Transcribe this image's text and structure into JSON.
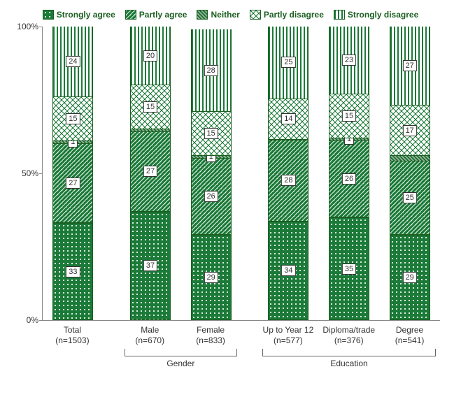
{
  "chart_data": {
    "type": "bar",
    "stacked": true,
    "ylim": [
      0,
      100
    ],
    "yticks": [
      "0%",
      "50%",
      "100%"
    ],
    "legend": [
      "Strongly agree",
      "Partly agree",
      "Neither",
      "Partly disagree",
      "Strongly disagree"
    ],
    "categories": [
      {
        "label_line1": "Total",
        "label_line2": "(n=1503)"
      },
      {
        "label_line1": "Male",
        "label_line2": "(n=670)"
      },
      {
        "label_line1": "Female",
        "label_line2": "(n=833)"
      },
      {
        "label_line1": "Up to Year 12",
        "label_line2": "(n=577)"
      },
      {
        "label_line1": "Diploma/trade",
        "label_line2": "(n=376)"
      },
      {
        "label_line1": "Degree",
        "label_line2": "(n=541)"
      }
    ],
    "series": [
      {
        "name": "Strongly agree",
        "values": [
          33,
          37,
          29,
          34,
          35,
          29
        ]
      },
      {
        "name": "Partly agree",
        "values": [
          27,
          27,
          26,
          28,
          26,
          25
        ]
      },
      {
        "name": "Neither",
        "values": [
          1,
          1,
          1,
          0,
          1,
          2
        ]
      },
      {
        "name": "Partly disagree",
        "values": [
          15,
          15,
          15,
          14,
          15,
          17
        ]
      },
      {
        "name": "Strongly disagree",
        "values": [
          24,
          20,
          28,
          25,
          23,
          27
        ]
      }
    ],
    "value_labels": [
      [
        "33",
        "27",
        "1",
        "15",
        "24"
      ],
      [
        "37",
        "27",
        "",
        "15",
        "20"
      ],
      [
        "29",
        "26",
        "1",
        "15",
        "28"
      ],
      [
        "34",
        "28",
        "",
        "14",
        "25"
      ],
      [
        "35",
        "26",
        "1",
        "15",
        "23"
      ],
      [
        "29",
        "25",
        "",
        "17",
        "27"
      ]
    ],
    "groups": [
      {
        "name": "Gender",
        "cols": [
          1,
          2
        ]
      },
      {
        "name": "Education",
        "cols": [
          3,
          4,
          5
        ]
      }
    ]
  }
}
